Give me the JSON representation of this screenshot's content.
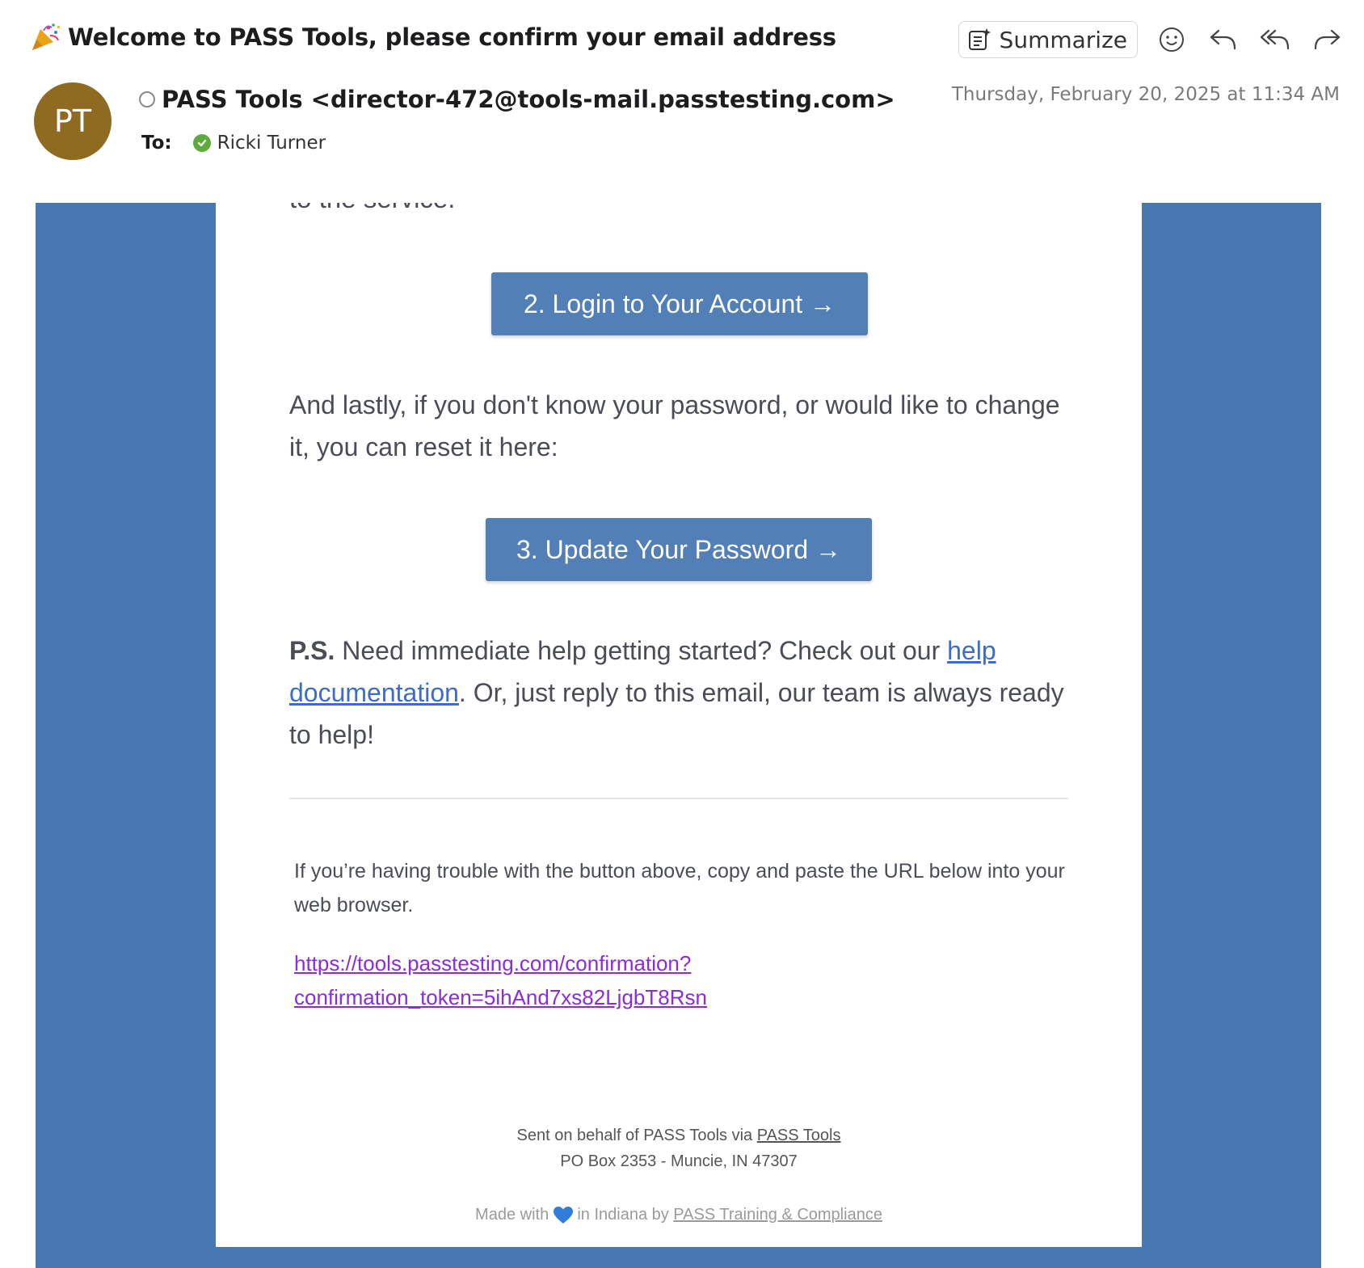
{
  "header": {
    "subject": "Welcome to PASS Tools, please confirm your email address",
    "summarize_label": "Summarize",
    "from": "PASS Tools <director-472@tools-mail.passtesting.com>",
    "avatar_initials": "PT",
    "avatar_color": "#8e6b21",
    "date": "Thursday, February 20, 2025 at 11:34 AM",
    "to_label": "To:",
    "to_name": "Ricki Turner",
    "actions": [
      "smiley-icon",
      "reply-icon",
      "reply-all-icon",
      "forward-icon"
    ]
  },
  "email": {
    "clipped_text": "to the service.",
    "login_button": "2. Login to Your Account →",
    "reset_text": "And lastly, if you don't know your password, or would like to change it, you can reset it here:",
    "password_button": "3. Update Your Password →",
    "ps_label": "P.S.",
    "ps_text_1": " Need immediate help getting started? Check out our ",
    "ps_link": "help documentation",
    "ps_text_2": ". Or, just reply to this email, our team is always ready to help!",
    "trouble_text": "If you’re having trouble with the button above, copy and paste the URL below into your web browser.",
    "url_line1": "https://tools.passtesting.com/confirmation?",
    "url_line2": "confirmation_token=5ihAnd7xs82LjgbT8Rsn",
    "footer_sent_prefix": "Sent on behalf of PASS Tools via ",
    "footer_sent_link": "PASS Tools",
    "footer_address": "PO Box 2353 - Muncie, IN 47307",
    "footer_made_prefix": "Made with ",
    "footer_made_middle": " in Indiana by ",
    "footer_made_link": "PASS Training & Compliance"
  },
  "colors": {
    "frame_blue": "#4778b2",
    "button_blue": "#527fb5",
    "link_blue": "#3d6cc9",
    "url_purple": "#8a2be2",
    "verified_green": "#5dab3a"
  }
}
